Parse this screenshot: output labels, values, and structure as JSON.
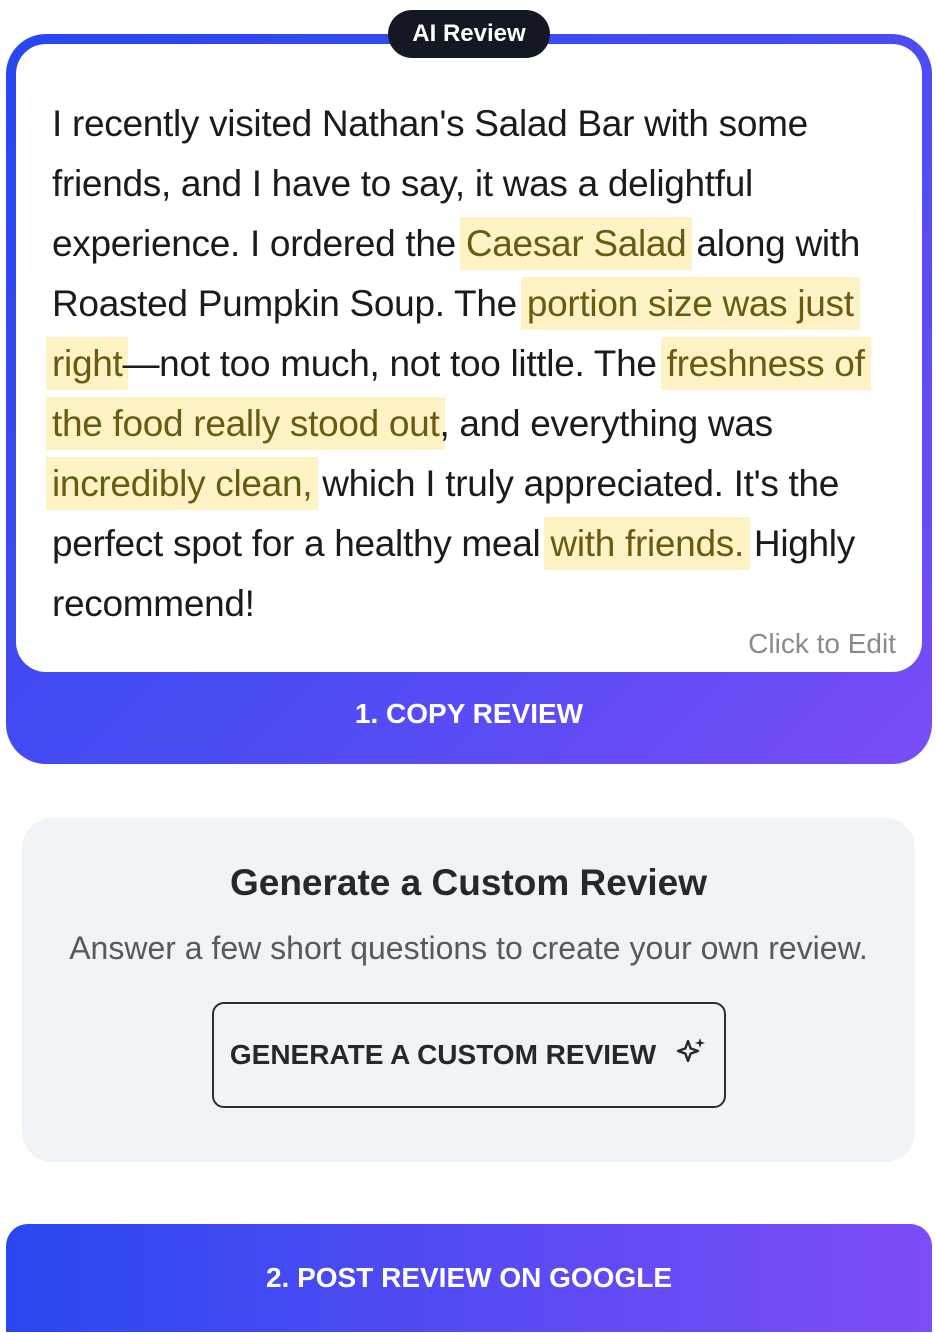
{
  "review_card": {
    "badge": "AI Review",
    "segments": [
      {
        "text": "I recently visited Nathan's Salad Bar with some friends, and I have to say, it was a delightful experience. I ordered the ",
        "hl": false
      },
      {
        "text": "Caesar Salad",
        "hl": true
      },
      {
        "text": " along with Roasted Pumpkin Soup. The ",
        "hl": false
      },
      {
        "text": "portion size was just right",
        "hl": true
      },
      {
        "text": "—not too much, not too little. The ",
        "hl": false
      },
      {
        "text": "freshness of the food really stood out",
        "hl": true
      },
      {
        "text": ", and everything was ",
        "hl": false
      },
      {
        "text": "incredibly clean,",
        "hl": true
      },
      {
        "text": " which I truly appreciated. It's the perfect spot for a healthy meal ",
        "hl": false
      },
      {
        "text": "with friends.",
        "hl": true
      },
      {
        "text": " Highly recommend!",
        "hl": false
      }
    ],
    "edit_hint": "Click to Edit",
    "copy_label": "1. COPY REVIEW"
  },
  "custom": {
    "title": "Generate a Custom Review",
    "subtitle": "Answer a few short questions to create your own review.",
    "button_label": "GENERATE A CUSTOM REVIEW",
    "button_icon": "sparkle-icon"
  },
  "post": {
    "label": "2. POST REVIEW ON GOOGLE"
  },
  "colors": {
    "gradient_start": "#2747f0",
    "gradient_end": "#7a4cf6",
    "highlight_bg": "#fdf3c4",
    "badge_bg": "#141823",
    "panel_bg": "#f1f4f7"
  }
}
